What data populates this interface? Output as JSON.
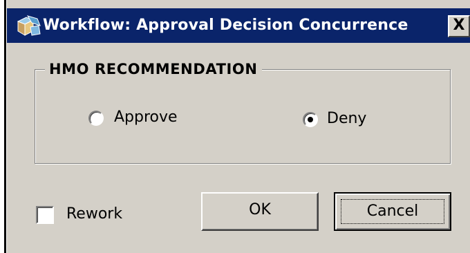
{
  "window": {
    "title": "Workflow: Approval Decision Concurrence",
    "close_glyph": "X",
    "icon": "workflow-app-icon"
  },
  "group": {
    "legend": "HMO RECOMMENDATION",
    "options": [
      {
        "label": "Approve",
        "selected": false
      },
      {
        "label": "Deny",
        "selected": true
      }
    ]
  },
  "rework": {
    "label": "Rework",
    "checked": false
  },
  "buttons": {
    "ok_label": "OK",
    "cancel_label": "Cancel"
  },
  "colors": {
    "titlebar": "#0a246a",
    "face": "#d4d0c8"
  }
}
